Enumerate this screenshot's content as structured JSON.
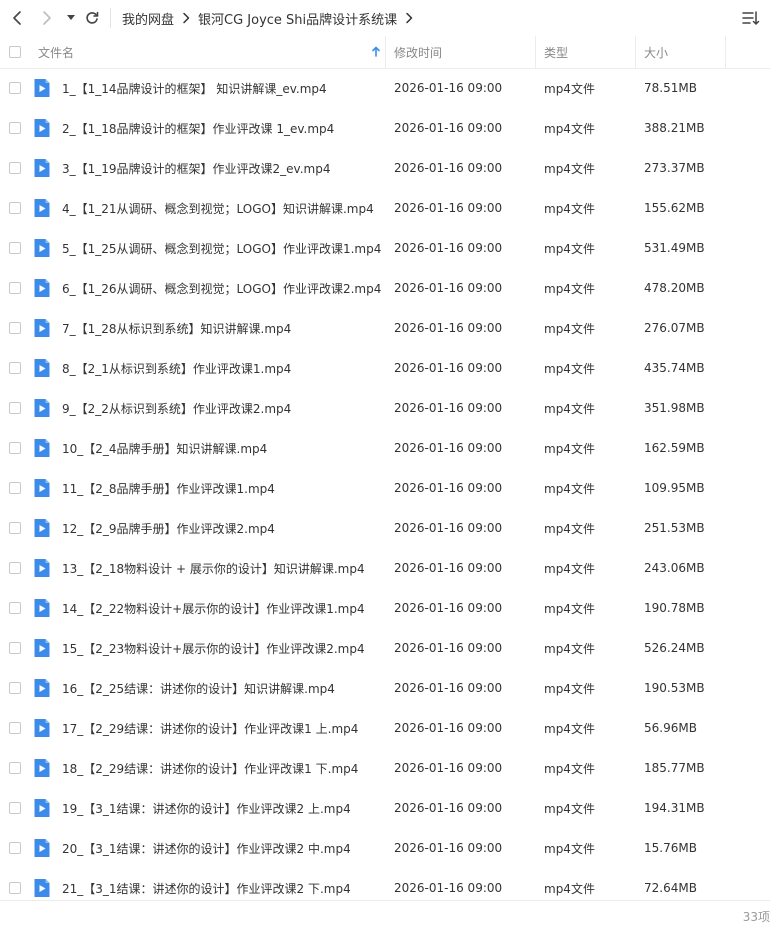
{
  "breadcrumb": [
    "我的网盘",
    "银河CG Joyce Shi品牌设计系统课"
  ],
  "columns": {
    "name": "文件名",
    "modified": "修改时间",
    "type": "类型",
    "size": "大小"
  },
  "colors": {
    "icon_blue": "#3d8be8",
    "sort_arrow": "#3d8be8",
    "text": "#333333",
    "muted": "#888888"
  },
  "files": [
    {
      "name": "1_【1_14品牌设计的框架】 知识讲解课_ev.mp4",
      "modified": "2026-01-16 09:00",
      "type": "mp4文件",
      "size": "78.51MB"
    },
    {
      "name": "2_【1_18品牌设计的框架】作业评改课 1_ev.mp4",
      "modified": "2026-01-16 09:00",
      "type": "mp4文件",
      "size": "388.21MB"
    },
    {
      "name": "3_【1_19品牌设计的框架】作业评改课2_ev.mp4",
      "modified": "2026-01-16 09:00",
      "type": "mp4文件",
      "size": "273.37MB"
    },
    {
      "name": "4_【1_21从调研、概念到视觉；LOGO】知识讲解课.mp4",
      "modified": "2026-01-16 09:00",
      "type": "mp4文件",
      "size": "155.62MB"
    },
    {
      "name": "5_【1_25从调研、概念到视觉；LOGO】作业评改课1.mp4",
      "modified": "2026-01-16 09:00",
      "type": "mp4文件",
      "size": "531.49MB"
    },
    {
      "name": "6_【1_26从调研、概念到视觉；LOGO】作业评改课2.mp4",
      "modified": "2026-01-16 09:00",
      "type": "mp4文件",
      "size": "478.20MB"
    },
    {
      "name": "7_【1_28从标识到系统】知识讲解课.mp4",
      "modified": "2026-01-16 09:00",
      "type": "mp4文件",
      "size": "276.07MB"
    },
    {
      "name": "8_【2_1从标识到系统】作业评改课1.mp4",
      "modified": "2026-01-16 09:00",
      "type": "mp4文件",
      "size": "435.74MB"
    },
    {
      "name": "9_【2_2从标识到系统】作业评改课2.mp4",
      "modified": "2026-01-16 09:00",
      "type": "mp4文件",
      "size": "351.98MB"
    },
    {
      "name": "10_【2_4品牌手册】知识讲解课.mp4",
      "modified": "2026-01-16 09:00",
      "type": "mp4文件",
      "size": "162.59MB"
    },
    {
      "name": "11_【2_8品牌手册】作业评改课1.mp4",
      "modified": "2026-01-16 09:00",
      "type": "mp4文件",
      "size": "109.95MB"
    },
    {
      "name": "12_【2_9品牌手册】作业评改课2.mp4",
      "modified": "2026-01-16 09:00",
      "type": "mp4文件",
      "size": "251.53MB"
    },
    {
      "name": "13_【2_18物料设计 + 展示你的设计】知识讲解课.mp4",
      "modified": "2026-01-16 09:00",
      "type": "mp4文件",
      "size": "243.06MB"
    },
    {
      "name": "14_【2_22物料设计+展示你的设计】作业评改课1.mp4",
      "modified": "2026-01-16 09:00",
      "type": "mp4文件",
      "size": "190.78MB"
    },
    {
      "name": "15_【2_23物料设计+展示你的设计】作业评改课2.mp4",
      "modified": "2026-01-16 09:00",
      "type": "mp4文件",
      "size": "526.24MB"
    },
    {
      "name": "16_【2_25结课：讲述你的设计】知识讲解课.mp4",
      "modified": "2026-01-16 09:00",
      "type": "mp4文件",
      "size": "190.53MB"
    },
    {
      "name": "17_【2_29结课：讲述你的设计】作业评改课1 上.mp4",
      "modified": "2026-01-16 09:00",
      "type": "mp4文件",
      "size": "56.96MB"
    },
    {
      "name": "18_【2_29结课：讲述你的设计】作业评改课1 下.mp4",
      "modified": "2026-01-16 09:00",
      "type": "mp4文件",
      "size": "185.77MB"
    },
    {
      "name": "19_【3_1结课：讲述你的设计】作业评改课2 上.mp4",
      "modified": "2026-01-16 09:00",
      "type": "mp4文件",
      "size": "194.31MB"
    },
    {
      "name": "20_【3_1结课：讲述你的设计】作业评改课2 中.mp4",
      "modified": "2026-01-16 09:00",
      "type": "mp4文件",
      "size": "15.76MB"
    },
    {
      "name": "21_【3_1结课：讲述你的设计】作业评改课2 下.mp4",
      "modified": "2026-01-16 09:00",
      "type": "mp4文件",
      "size": "72.64MB"
    }
  ],
  "footer": {
    "count": "33项"
  }
}
